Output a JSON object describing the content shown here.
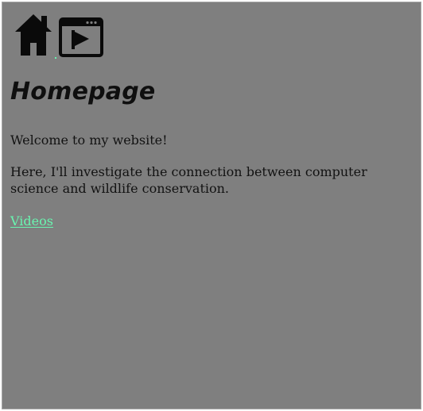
{
  "nav": {
    "home_icon": "home-icon",
    "video_player_icon": "video-player-icon"
  },
  "main": {
    "title": "Homepage",
    "paragraphs": [
      "Welcome to my website!",
      "Here, I'll investigate the connection between computer science and wildlife conservation."
    ],
    "videos_link": "Videos"
  },
  "colors": {
    "background": "#7f7f7f",
    "link": "#69f5b0",
    "text": "#121212"
  }
}
